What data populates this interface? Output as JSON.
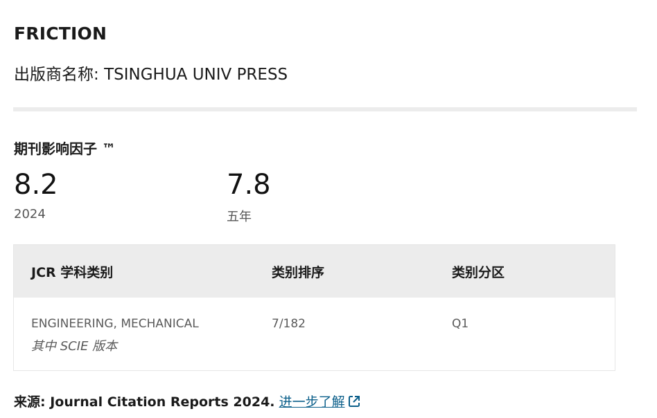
{
  "journal": {
    "title": "FRICTION",
    "publisher_label": "出版商名称: ",
    "publisher_name": "TSINGHUA UNIV PRESS"
  },
  "impact": {
    "section_title": "期刊影响因子 ™",
    "metrics": [
      {
        "value": "8.2",
        "label": "2024"
      },
      {
        "value": "7.8",
        "label": "五年"
      }
    ]
  },
  "jcr_table": {
    "headers": [
      "JCR 学科类别",
      "类别排序",
      "类别分区"
    ],
    "rows": [
      {
        "category": "ENGINEERING, MECHANICAL",
        "edition": "其中 SCIE 版本",
        "rank": "7/182",
        "quartile": "Q1"
      }
    ]
  },
  "source": {
    "label": "来源:",
    "text": " Journal Citation Reports  2024.",
    "link_text": "进一步了解",
    "link_icon": "external-link-icon",
    "link_color": "#0b5f8a"
  }
}
